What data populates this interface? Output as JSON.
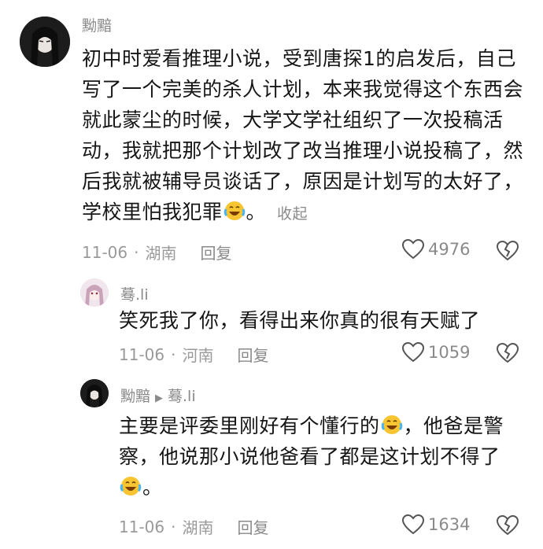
{
  "comments": [
    {
      "username": "黝黯",
      "lines": [
        "初中时爱看推理小说，受到唐探1的启发后，自己",
        "写了一个完美的杀人计划，本来我觉得这个东西会",
        "就此蒙尘的时候，大学文学社组织了一次投稿活",
        "动，我就把那个计划改了改当推理小说投稿了，然",
        "后我就被辅导员谈话了，原因是计划写的太好了，",
        "学校里怕我犯罪"
      ],
      "tail": "。",
      "collapse_label": "收起",
      "date": "11-06",
      "location": "湖南",
      "reply_label": "回复",
      "likes": "4976"
    },
    {
      "username": "蓦.li",
      "lines": [
        "笑死我了你，看得出来你真的很有天赋了"
      ],
      "date": "11-06",
      "location": "河南",
      "reply_label": "回复",
      "likes": "1059"
    },
    {
      "username": "黝黯",
      "reply_to": "蓦.li",
      "line1_a": "主要是评委里刚好有个懂行的",
      "line1_b": "，他爸是警",
      "line2": "察，他说那小说他爸看了都是这计划不得了",
      "line3": "。",
      "date": "11-06",
      "location": "湖南",
      "reply_label": "回复",
      "likes": "1634"
    }
  ],
  "icons": {
    "like": "heart-outline-icon",
    "dislike": "broken-heart-icon",
    "emoji": "laughing-tears-emoji-icon",
    "reply_arrow": "right-triangle-icon"
  }
}
